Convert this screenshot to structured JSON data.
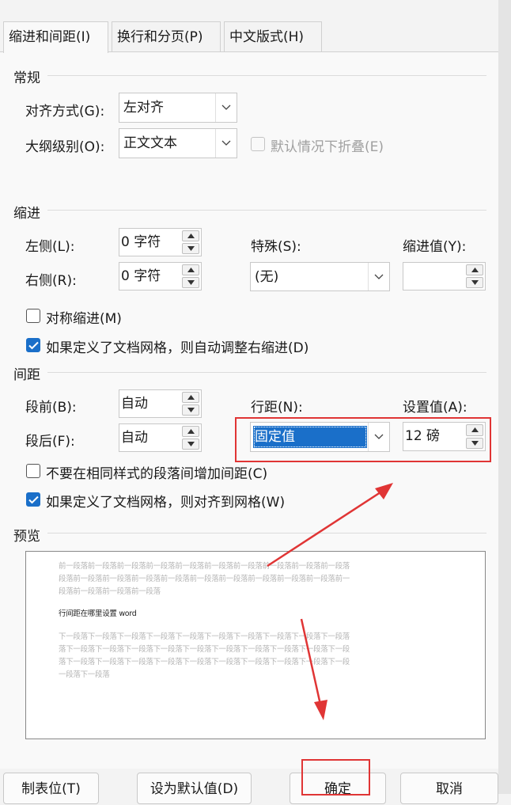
{
  "tabs": [
    {
      "label": "缩进和间距(I)",
      "active": true
    },
    {
      "label": "换行和分页(P)",
      "active": false
    },
    {
      "label": "中文版式(H)",
      "active": false
    }
  ],
  "general": {
    "title": "常规",
    "alignment_label": "对齐方式(G):",
    "alignment_value": "左对齐",
    "outline_label": "大纲级别(O):",
    "outline_value": "正文文本",
    "collapse_label": "默认情况下折叠(E)"
  },
  "indent": {
    "title": "缩进",
    "left_label": "左侧(L):",
    "left_value": "0 字符",
    "right_label": "右侧(R):",
    "right_value": "0 字符",
    "special_label": "特殊(S):",
    "special_value": "(无)",
    "by_label": "缩进值(Y):",
    "by_value": "",
    "mirror_label": "对称缩进(M)",
    "auto_adjust_label": "如果定义了文档网格，则自动调整右缩进(D)"
  },
  "spacing": {
    "title": "间距",
    "before_label": "段前(B):",
    "before_value": "自动",
    "after_label": "段后(F):",
    "after_value": "自动",
    "line_label": "行距(N):",
    "line_value": "固定值",
    "at_label": "设置值(A):",
    "at_value": "12 磅",
    "no_space_label": "不要在相同样式的段落间增加间距(C)",
    "snap_grid_label": "如果定义了文档网格，则对齐到网格(W)"
  },
  "preview": {
    "title": "预览",
    "prev_lines": [
      "前一段落前一段落前一段落前一段落前一段落前一段落前一段落前一段落前一段落前一段落",
      "段落前一段落前一段落前一段落前一段落前一段落前一段落前一段落前一段落前一段落前一",
      "段落前一段落前一段落前一段落"
    ],
    "sample_line": "行间距在哪里设置 word",
    "next_lines": [
      "下一段落下一段落下一段落下一段落下一段落下一段落下一段落下一段落下一段落下一段落",
      "落下一段落下一段落下一段落下一段落下一段落下一段落下一段落下一段落下一段落下一段",
      "落下一段落下一段落下一段落下一段落下一段落下一段落下一段落下一段落下一段落下一段",
      "一段落下一段落"
    ]
  },
  "buttons": {
    "tabs": "制表位(T)",
    "set_default": "设为默认值(D)",
    "ok": "确定",
    "cancel": "取消"
  },
  "colors": {
    "accent": "#1a6fc9",
    "annotation": "#e03535"
  }
}
